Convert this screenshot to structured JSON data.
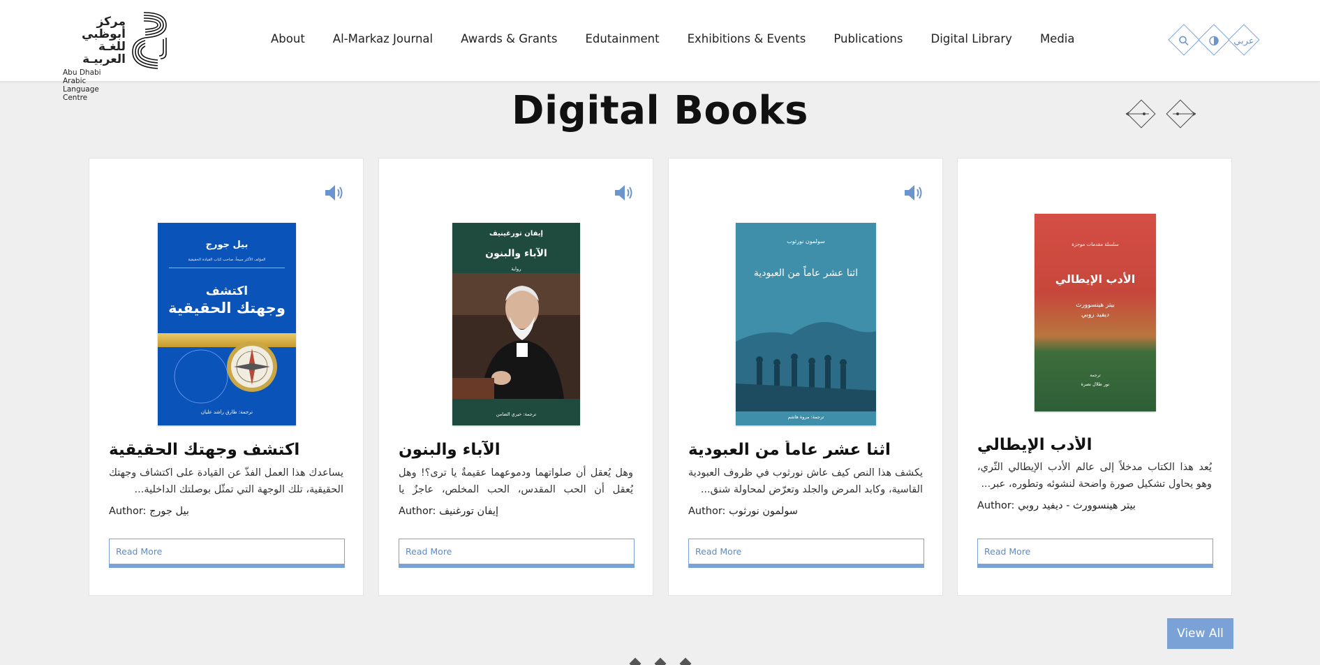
{
  "header": {
    "logo": {
      "ar_line1": "مركز أبوظبي",
      "ar_line2": "للغـة العربيـة",
      "en_line1": "Abu Dhabi Arabic",
      "en_line2": "Language Centre"
    },
    "nav": [
      "About",
      "Al-Markaz Journal",
      "Awards & Grants",
      "Edutainment",
      "Exhibitions & Events",
      "Publications",
      "Digital Library",
      "Media"
    ],
    "icons": {
      "search": "search-icon",
      "accessibility": "accessibility-icon",
      "language_label": "عربي"
    },
    "accent_color": "#7aa2d6"
  },
  "section": {
    "title": "Digital Books",
    "view_all_label": "View All"
  },
  "books": [
    {
      "title": "اكتشف وجهتك الحقيقية",
      "description": "يساعدك هذا العمل الفذّ عن القيادة على اكتشاف وجهتك الحقيقية، تلك الوجهة التي تمثّل بوصلتك الداخلية...",
      "author": "Author: بيل جورج",
      "read_more": "Read More",
      "cover": {
        "author": "بيل جورج",
        "subtitle": "المؤلف الأكثر مبيعاً، صاحب كتاب القيادة الحقيقية",
        "title1": "اكتشف",
        "title2": "وجهتك الحقيقية",
        "translator": "ترجمة: طارق راشد عليان",
        "color": "#0a53b8"
      }
    },
    {
      "title": "الآباء والبنون",
      "description": "وهل يُعقل أن صلواتهما ودموعهما عقيمةٌ يا ترى؟! وهل يُعقل أن الحب المقدس، الحب المخلص، عاجزٌ يا ترى؟!...",
      "author": "Author: إيفان تورغنيف",
      "read_more": "Read More",
      "cover": {
        "author": "إيفان تورغينيف",
        "title1": "الآباء والبنون",
        "genre": "رواية",
        "translator": "ترجمة: خيري الضامن",
        "color": "#1f4a3e"
      }
    },
    {
      "title": "اثنا عشر عاماً من العبودية",
      "description": "يكشف هذا النص كيف عاش نورثوب في ظروف العبودية القاسية، وكابد المرض والجلد وتعرّض لمحاولة شنق...",
      "author": "Author: سولمون نورثوب",
      "read_more": "Read More",
      "cover": {
        "author": "سولمون نورثوب",
        "title1": "اثنا عشر عاماً من العبودية",
        "translator": "ترجمة: مروة هاشم",
        "color": "#3f8fab"
      }
    },
    {
      "title": "الأدب الإيطالي",
      "description": "يُعد هذا الكتاب مدخلاً إلى عالم الأدب الإيطالي الثّري، وهو يحاول تشكيل صورة واضحة لنشوئه وتطوره، عبر...",
      "author": "Author: بيتر هينسوورث - ديفيد روبي",
      "read_more": "Read More",
      "cover": {
        "series": "سلسلة مقدمات موجزة",
        "title1": "الأدب الإيطالي",
        "author1": "بيتر هينسوورث",
        "author2": "ديفيد روبي",
        "translator_label": "ترجمة",
        "translator": "نور طلال نصرة",
        "color": "#c94a3c"
      }
    }
  ]
}
